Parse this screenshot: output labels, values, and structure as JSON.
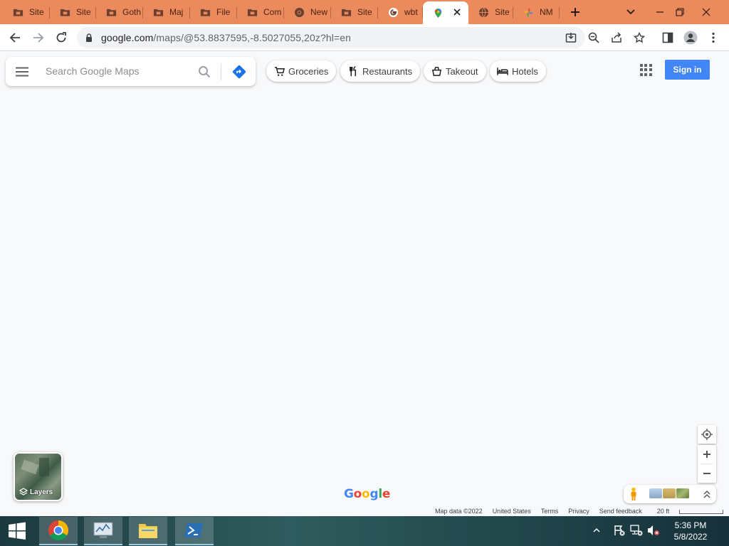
{
  "browser": {
    "tabs": [
      {
        "label": "Site",
        "icon": "folder-icon"
      },
      {
        "label": "Site",
        "icon": "folder-icon"
      },
      {
        "label": "Goth",
        "icon": "folder-icon"
      },
      {
        "label": "Maj",
        "icon": "folder-icon"
      },
      {
        "label": "File",
        "icon": "folder-icon"
      },
      {
        "label": "Com",
        "icon": "folder-icon"
      },
      {
        "label": "New",
        "icon": "chrome-icon"
      },
      {
        "label": "Site",
        "icon": "folder-icon"
      },
      {
        "label": "wbt",
        "icon": "google-g-icon"
      },
      {
        "label": "",
        "icon": "google-maps-pin-icon",
        "active": true
      },
      {
        "label": "Site",
        "icon": "globe-icon"
      },
      {
        "label": "NM",
        "icon": "photos-pinwheel-icon"
      }
    ],
    "url_host": "google.com",
    "url_path": "/maps/@53.8837595,-8.5027055,20z?hl=en",
    "accent": "#eb8a5c"
  },
  "maps": {
    "search_placeholder": "Search Google Maps",
    "chips": {
      "groceries": "Groceries",
      "restaurants": "Restaurants",
      "takeout": "Takeout",
      "hotels": "Hotels"
    },
    "sign_in": "Sign in",
    "layers_label": "Layers",
    "footer": {
      "map_data": "Map data ©2022",
      "country": "United States",
      "terms": "Terms",
      "privacy": "Privacy",
      "feedback": "Send feedback",
      "scale": "20 ft"
    },
    "logo_letters": [
      "G",
      "o",
      "o",
      "g",
      "l",
      "e"
    ],
    "signin_color": "#4285f4"
  },
  "taskbar": {
    "time": "5:36 PM",
    "date": "5/8/2022"
  }
}
